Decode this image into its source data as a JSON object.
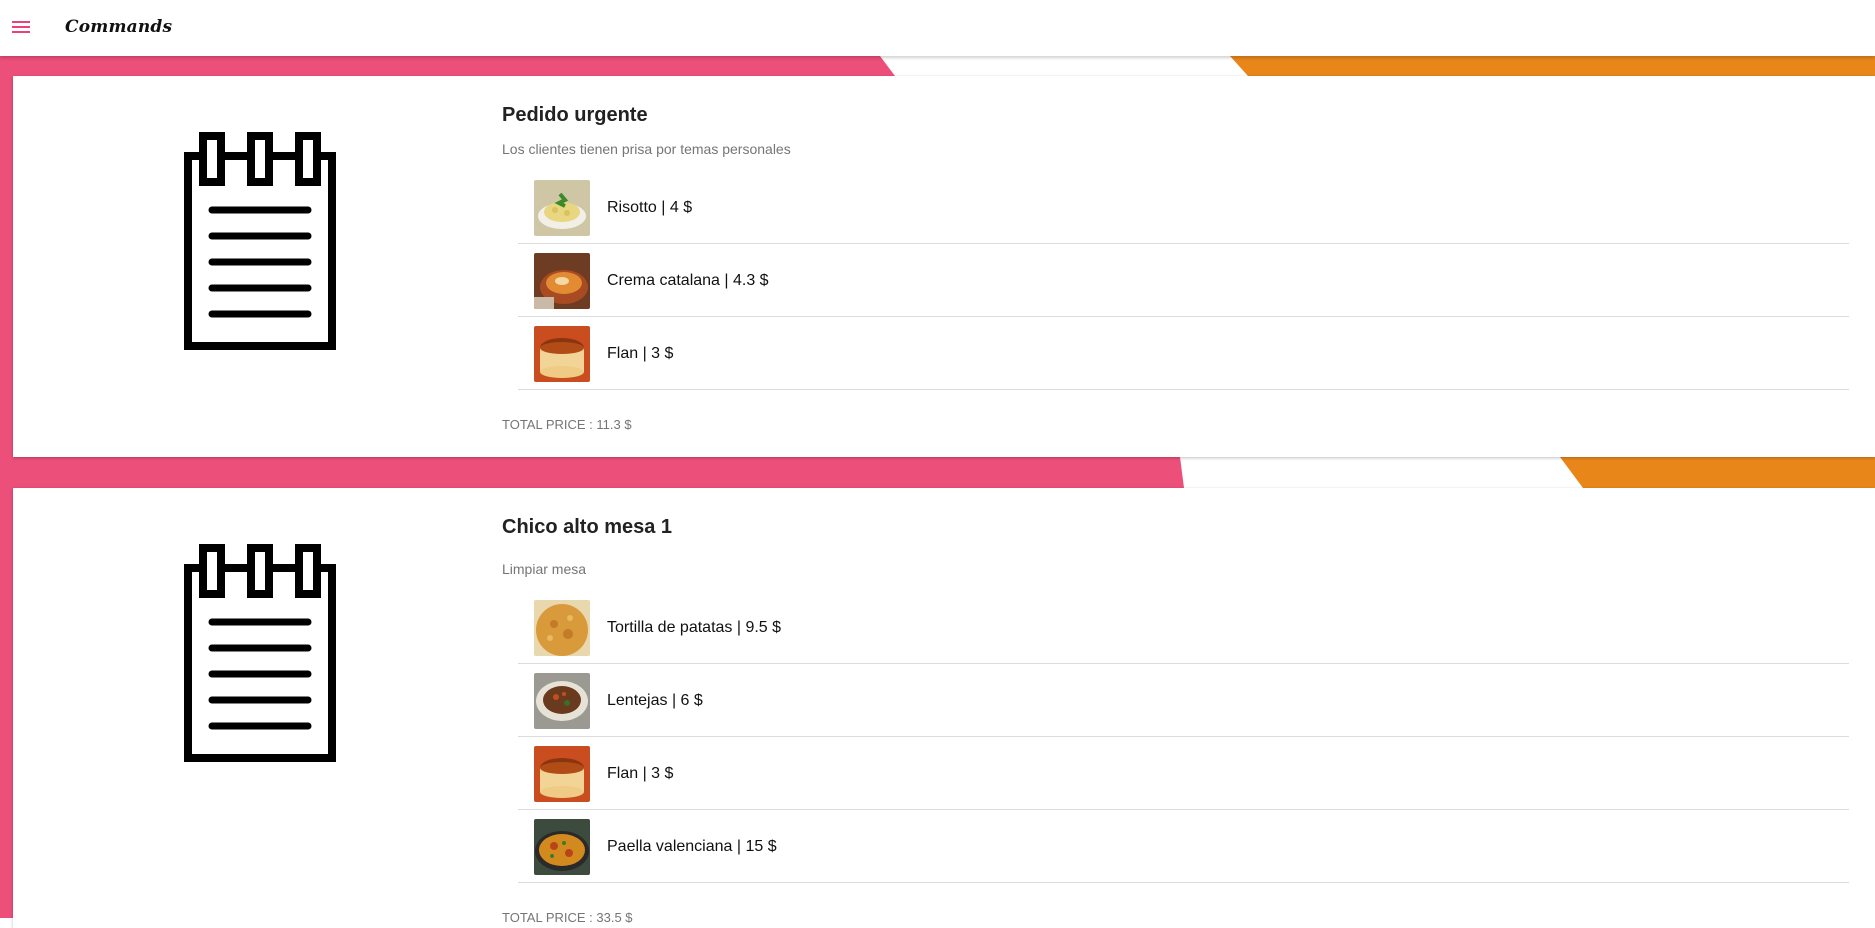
{
  "app": {
    "title": "Commands"
  },
  "icons": {
    "menu": "menu-icon",
    "order": "notepad-icon"
  },
  "colors": {
    "pink": "#ec4f7a",
    "orange": "#e8861a",
    "accent": "#ec407a"
  },
  "orders": [
    {
      "title": "Pedido urgente",
      "description": "Los clientes tienen prisa por temas personales",
      "items": [
        {
          "label": "Risotto | 4 $",
          "image": "risotto"
        },
        {
          "label": "Crema catalana | 4.3 $",
          "image": "crema-catalana"
        },
        {
          "label": "Flan | 3 $",
          "image": "flan"
        }
      ],
      "total": "TOTAL PRICE : 11.3 $"
    },
    {
      "title": "Chico alto mesa 1",
      "description": "Limpiar mesa",
      "items": [
        {
          "label": "Tortilla de patatas | 9.5 $",
          "image": "tortilla"
        },
        {
          "label": "Lentejas | 6 $",
          "image": "lentejas"
        },
        {
          "label": "Flan | 3 $",
          "image": "flan"
        },
        {
          "label": "Paella valenciana | 15 $",
          "image": "paella"
        }
      ],
      "total": "TOTAL PRICE : 33.5 $"
    }
  ]
}
